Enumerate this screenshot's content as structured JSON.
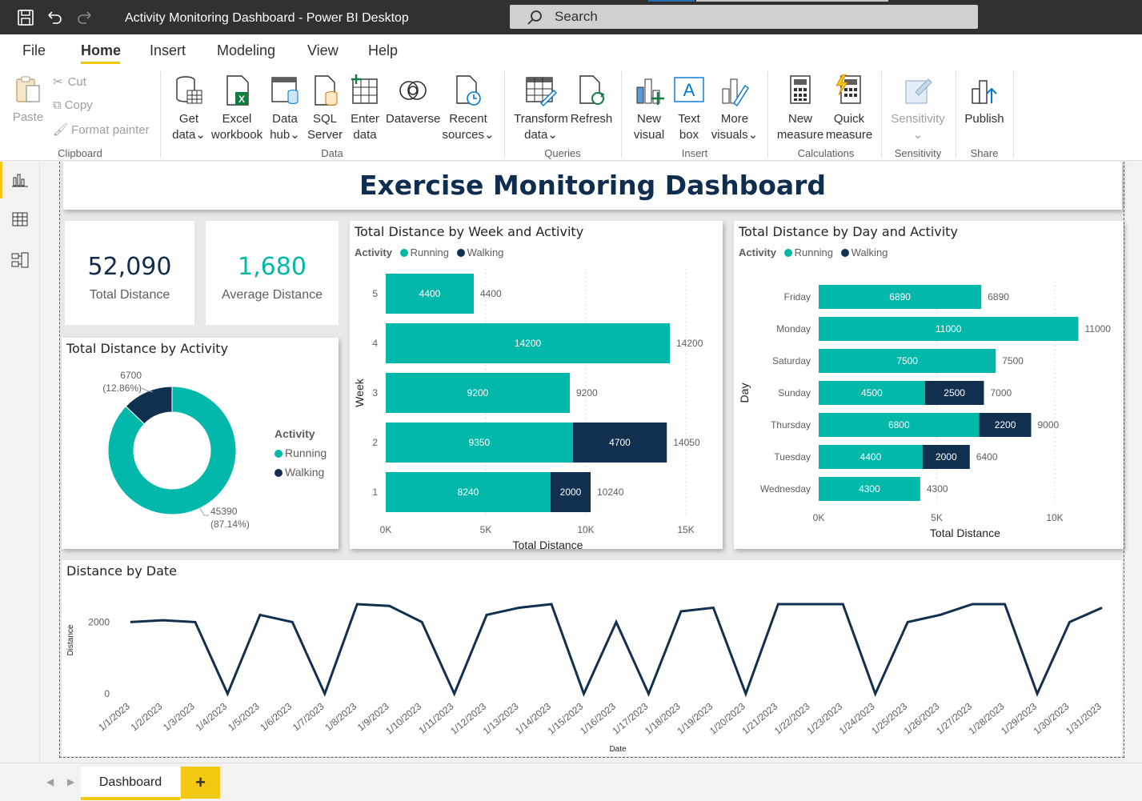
{
  "window": {
    "title": "Activity Monitoring Dashboard - Power BI Desktop",
    "search_placeholder": "Search"
  },
  "menu": {
    "tabs": [
      "File",
      "Home",
      "Insert",
      "Modeling",
      "View",
      "Help"
    ],
    "active": "Home"
  },
  "ribbon": {
    "clipboard": {
      "paste": "Paste",
      "cut": "Cut",
      "copy": "Copy",
      "format_painter": "Format painter",
      "label": "Clipboard"
    },
    "data": {
      "get_data": [
        "Get",
        "data"
      ],
      "excel": [
        "Excel",
        "workbook"
      ],
      "data_hub": [
        "Data",
        "hub"
      ],
      "sql": [
        "SQL",
        "Server"
      ],
      "enter": [
        "Enter",
        "data"
      ],
      "dataverse": "Dataverse",
      "recent": [
        "Recent",
        "sources"
      ],
      "label": "Data"
    },
    "queries": {
      "transform": [
        "Transform",
        "data"
      ],
      "refresh": "Refresh",
      "label": "Queries"
    },
    "insert": {
      "new_visual": [
        "New",
        "visual"
      ],
      "text_box": [
        "Text",
        "box"
      ],
      "more_visuals": [
        "More",
        "visuals"
      ],
      "label": "Insert"
    },
    "calculations": {
      "new_measure": [
        "New",
        "measure"
      ],
      "quick_measure": [
        "Quick",
        "measure"
      ],
      "label": "Calculations"
    },
    "sensitivity": {
      "button": "Sensitivity",
      "label": "Sensitivity"
    },
    "share": {
      "publish": "Publish",
      "label": "Share"
    }
  },
  "dashboard": {
    "title": "Exercise Monitoring Dashboard",
    "kpis": [
      {
        "value": "52,090",
        "label": "Total Distance",
        "color": "#0f2d4f"
      },
      {
        "value": "1,680",
        "label": "Average Distance",
        "color": "#01b8aa"
      }
    ]
  },
  "colors": {
    "running": "#01b8aa",
    "walking": "#11304f",
    "accent": "#f2c811"
  },
  "chart_data": [
    {
      "type": "pie",
      "title": "Total Distance by Activity",
      "legend_title": "Activity",
      "categories": [
        "Running",
        "Walking"
      ],
      "values": [
        45390,
        6700
      ],
      "labels": [
        [
          "45390",
          "(87.14%)"
        ],
        [
          "6700",
          "(12.86%)"
        ]
      ]
    },
    {
      "type": "bar",
      "title": "Total Distance by Week and Activity",
      "legend_title": "Activity",
      "xlabel": "Total Distance",
      "ylabel": "Week",
      "categories": [
        "5",
        "4",
        "3",
        "2",
        "1"
      ],
      "series": [
        {
          "name": "Running",
          "values": [
            4400,
            14200,
            9200,
            9350,
            8240
          ]
        },
        {
          "name": "Walking",
          "values": [
            0,
            0,
            0,
            4700,
            2000
          ]
        }
      ],
      "totals": [
        4400,
        14200,
        9200,
        14050,
        10240
      ],
      "xlim": [
        0,
        15000
      ],
      "xticks": [
        "0K",
        "5K",
        "10K",
        "15K"
      ]
    },
    {
      "type": "bar",
      "title": "Total Distance by Day and Activity",
      "legend_title": "Activity",
      "xlabel": "Total Distance",
      "ylabel": "Day",
      "categories": [
        "Friday",
        "Monday",
        "Saturday",
        "Sunday",
        "Thursday",
        "Tuesday",
        "Wednesday"
      ],
      "series": [
        {
          "name": "Running",
          "values": [
            6890,
            11000,
            7500,
            4500,
            6800,
            4400,
            4300
          ]
        },
        {
          "name": "Walking",
          "values": [
            0,
            0,
            0,
            2500,
            2200,
            2000,
            0
          ]
        }
      ],
      "totals": [
        6890,
        11000,
        7500,
        7000,
        9000,
        6400,
        4300
      ],
      "xlim": [
        0,
        10000
      ],
      "xticks": [
        "0K",
        "5K",
        "10K"
      ]
    },
    {
      "type": "line",
      "title": "Distance by Date",
      "xlabel": "Date",
      "ylabel": "Distance",
      "x": [
        "1/1/2023",
        "1/2/2023",
        "1/3/2023",
        "1/4/2023",
        "1/5/2023",
        "1/6/2023",
        "1/7/2023",
        "1/8/2023",
        "1/9/2023",
        "1/10/2023",
        "1/11/2023",
        "1/12/2023",
        "1/13/2023",
        "1/14/2023",
        "1/15/2023",
        "1/16/2023",
        "1/17/2023",
        "1/18/2023",
        "1/19/2023",
        "1/20/2023",
        "1/21/2023",
        "1/22/2023",
        "1/23/2023",
        "1/24/2023",
        "1/25/2023",
        "1/26/2023",
        "1/27/2023",
        "1/28/2023",
        "1/29/2023",
        "1/30/2023",
        "1/31/2023"
      ],
      "y": [
        2000,
        2050,
        2000,
        0,
        2200,
        2000,
        0,
        2500,
        2450,
        2000,
        0,
        2200,
        2400,
        2500,
        0,
        2000,
        0,
        2300,
        2400,
        0,
        2500,
        2500,
        2500,
        0,
        2000,
        2200,
        2500,
        2500,
        0,
        2000,
        2400
      ],
      "ylim": [
        0,
        2500
      ],
      "yticks": [
        "0",
        "2000"
      ]
    }
  ],
  "bottom": {
    "page_tab": "Dashboard",
    "add": "+"
  }
}
